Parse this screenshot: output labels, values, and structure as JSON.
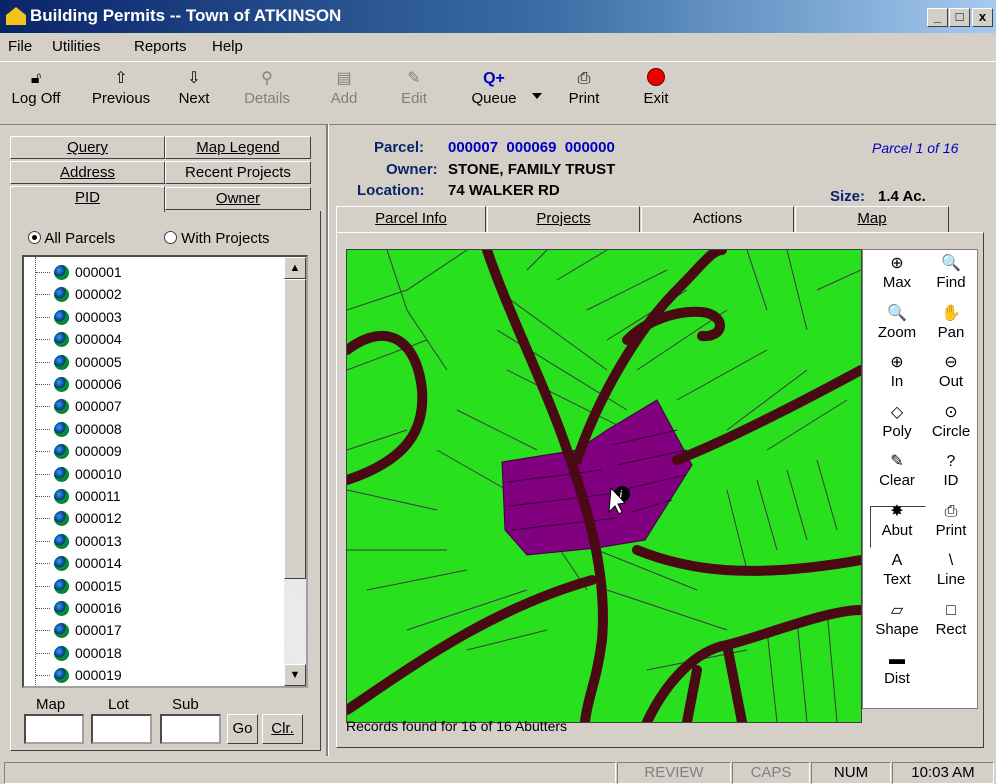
{
  "window": {
    "title": "Building Permits -- Town of ATKINSON",
    "min": "_",
    "max": "□",
    "close": "x"
  },
  "menu": [
    "File",
    "Utilities",
    "Reports",
    "Help"
  ],
  "toolbar": {
    "logoff": "Log Off",
    "previous": "Previous",
    "next": "Next",
    "details": "Details",
    "add": "Add",
    "edit": "Edit",
    "queue": "Queue",
    "print": "Print",
    "exit": "Exit"
  },
  "left_tabs": {
    "query": "Query",
    "map_legend": "Map Legend",
    "address": "Address",
    "recent_projects": "Recent Projects",
    "pid": "PID",
    "owner": "Owner"
  },
  "filter": {
    "all": "All Parcels",
    "with_projects": "With Projects",
    "selected": "all"
  },
  "parcels": [
    "000001",
    "000002",
    "000003",
    "000004",
    "000005",
    "000006",
    "000007",
    "000008",
    "000009",
    "000010",
    "000011",
    "000012",
    "000013",
    "000014",
    "000015",
    "000016",
    "000017",
    "000018",
    "000019"
  ],
  "search": {
    "map_label": "Map",
    "lot_label": "Lot",
    "sub_label": "Sub",
    "map_value": "",
    "lot_value": "",
    "sub_value": "",
    "go": "Go",
    "clear": "Clr."
  },
  "parcel": {
    "parcel_label": "Parcel:",
    "parcel_value": "000007  000069  000000",
    "owner_label": "Owner:",
    "owner_value": "STONE, FAMILY TRUST",
    "location_label": "Location:",
    "location_value": "74 WALKER RD",
    "size_label": "Size:",
    "size_value": "1.4 Ac.",
    "counter": "Parcel 1 of 16"
  },
  "right_tabs": {
    "parcel_info": "Parcel Info",
    "projects": "Projects",
    "actions": "Actions",
    "map": "Map"
  },
  "map_tools": [
    {
      "icon": "zoom-max-icon",
      "glyph": "⊕",
      "label": "Max"
    },
    {
      "icon": "find-icon",
      "glyph": "🔍",
      "label": "Find"
    },
    {
      "icon": "zoom-icon",
      "glyph": "🔍",
      "label": "Zoom"
    },
    {
      "icon": "pan-icon",
      "glyph": "✋",
      "label": "Pan"
    },
    {
      "icon": "zoom-in-icon",
      "glyph": "⊕",
      "label": "In"
    },
    {
      "icon": "zoom-out-icon",
      "glyph": "⊖",
      "label": "Out"
    },
    {
      "icon": "polygon-icon",
      "glyph": "◇",
      "label": "Poly"
    },
    {
      "icon": "circle-icon",
      "glyph": "⊙",
      "label": "Circle"
    },
    {
      "icon": "clear-icon",
      "glyph": "✎",
      "label": "Clear"
    },
    {
      "icon": "identify-icon",
      "glyph": "?",
      "label": "ID"
    },
    {
      "icon": "abutters-icon",
      "glyph": "✸",
      "label": "Abut"
    },
    {
      "icon": "print-icon",
      "glyph": "⎙",
      "label": "Print"
    },
    {
      "icon": "text-icon",
      "glyph": "A",
      "label": "Text"
    },
    {
      "icon": "line-icon",
      "glyph": "\\",
      "label": "Line"
    },
    {
      "icon": "shape-icon",
      "glyph": "▱",
      "label": "Shape"
    },
    {
      "icon": "rectangle-icon",
      "glyph": "□",
      "label": "Rect"
    },
    {
      "icon": "distance-icon",
      "glyph": "▬",
      "label": "Dist"
    }
  ],
  "records_status": "Records found for 16 of 16 Abutters",
  "statusbar": {
    "review": "REVIEW",
    "caps": "CAPS",
    "num": "NUM",
    "time": "10:03 AM"
  },
  "colors": {
    "map_bg": "#29e01f",
    "road": "#4a0a14",
    "selected_parcel": "#800080",
    "title_blue": "#0a246a"
  }
}
